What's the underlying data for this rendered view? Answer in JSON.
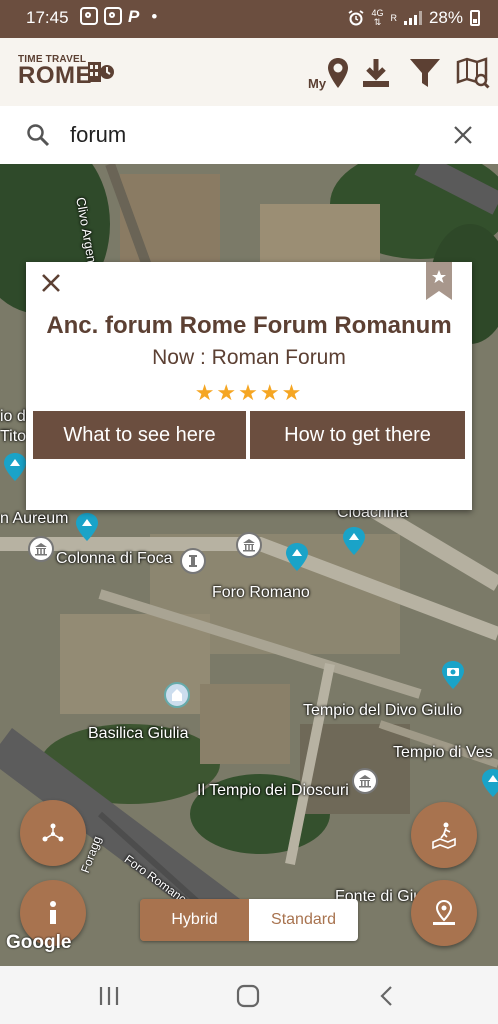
{
  "status_bar": {
    "time": "17:45",
    "network": "4G",
    "network_sub": "R",
    "battery": "28%"
  },
  "header": {
    "logo_small": "TIME TRAVEL",
    "logo_big": "ROME",
    "my_label": "My",
    "icons": [
      "location-pin-icon",
      "download-icon",
      "filter-icon",
      "map-search-icon"
    ]
  },
  "search": {
    "value": "forum",
    "placeholder": ""
  },
  "popup": {
    "title": "Anc. forum Rome Forum Romanum",
    "now": "Now :  Roman Forum",
    "stars": "★★★★★",
    "rating": 5,
    "button_see": "What to see here",
    "button_get": "How to get there"
  },
  "map_labels": [
    "Clivo Argentario",
    "io di",
    "Tito",
    "n Aureum",
    "Colonna di Foca",
    "Foro Romano",
    "Cloachina",
    "Basilica Giulia",
    "Tempio del Divo Giulio",
    "Tempio di Ves",
    "Il Tempio dei Dioscuri",
    "Foro Romano",
    "Foragg",
    "Fonte di Giut"
  ],
  "map_toggle": {
    "hybrid": "Hybrid",
    "standard": "Standard",
    "selected": "Hybrid"
  },
  "google_logo": "Google",
  "colors": {
    "brown_dark": "#6b4e3f",
    "brown_accent": "#a8734f",
    "star": "#f5a623",
    "tour_pin": "#1aa3c8"
  }
}
